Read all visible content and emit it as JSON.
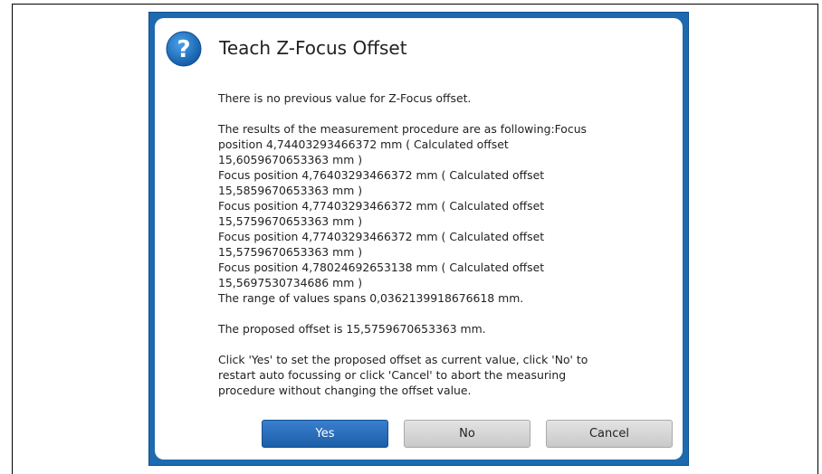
{
  "dialog": {
    "title": "Teach Z-Focus Offset",
    "icon": "question-mark-icon",
    "accent_color": "#1d6ab0",
    "intro": "There is no previous value for Z-Focus offset.",
    "results_lines": [
      "The results of the measurement procedure are as following:Focus",
      "position 4,74403293466372 mm ( Calculated offset",
      "15,6059670653363 mm )",
      "Focus position 4,76403293466372 mm ( Calculated offset",
      "15,5859670653363 mm )",
      "Focus position 4,77403293466372 mm ( Calculated offset",
      "15,5759670653363 mm )",
      "Focus position 4,77403293466372 mm ( Calculated offset",
      "15,5759670653363 mm )",
      "Focus position 4,78024692653138 mm ( Calculated offset",
      "15,5697530734686 mm )",
      "The range of values spans 0,0362139918676618 mm."
    ],
    "proposed": "The proposed offset is 15,5759670653363 mm.",
    "instruction_lines": [
      "Click 'Yes' to set the proposed offset as current value, click 'No' to",
      "restart auto focussing or click 'Cancel' to abort the measuring",
      "procedure without changing the offset value."
    ],
    "buttons": {
      "yes": "Yes",
      "no": "No",
      "cancel": "Cancel"
    }
  }
}
